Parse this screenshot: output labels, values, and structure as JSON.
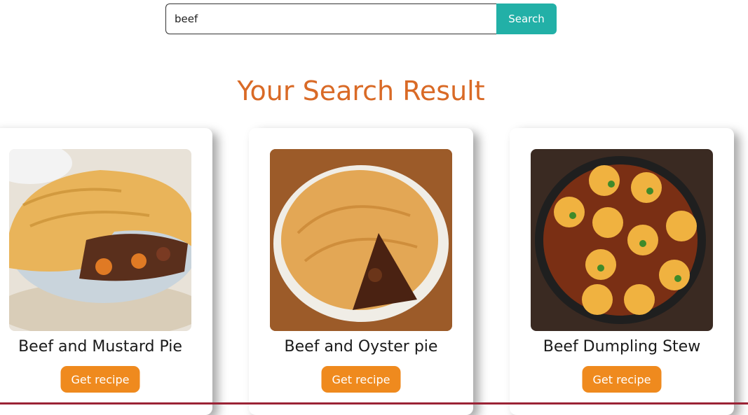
{
  "search": {
    "value": "beef",
    "button_label": "Search"
  },
  "results": {
    "heading": "Your Search Result",
    "cards": [
      {
        "title": "Beef and Mustard Pie",
        "button_label": "Get recipe"
      },
      {
        "title": "Beef and Oyster pie",
        "button_label": "Get recipe"
      },
      {
        "title": "Beef Dumpling Stew",
        "button_label": "Get recipe"
      }
    ]
  },
  "colors": {
    "heading": "#d96a26",
    "search_button": "#22b0a7",
    "recipe_button": "#ef8a1e",
    "footer_line": "#9b2335"
  }
}
